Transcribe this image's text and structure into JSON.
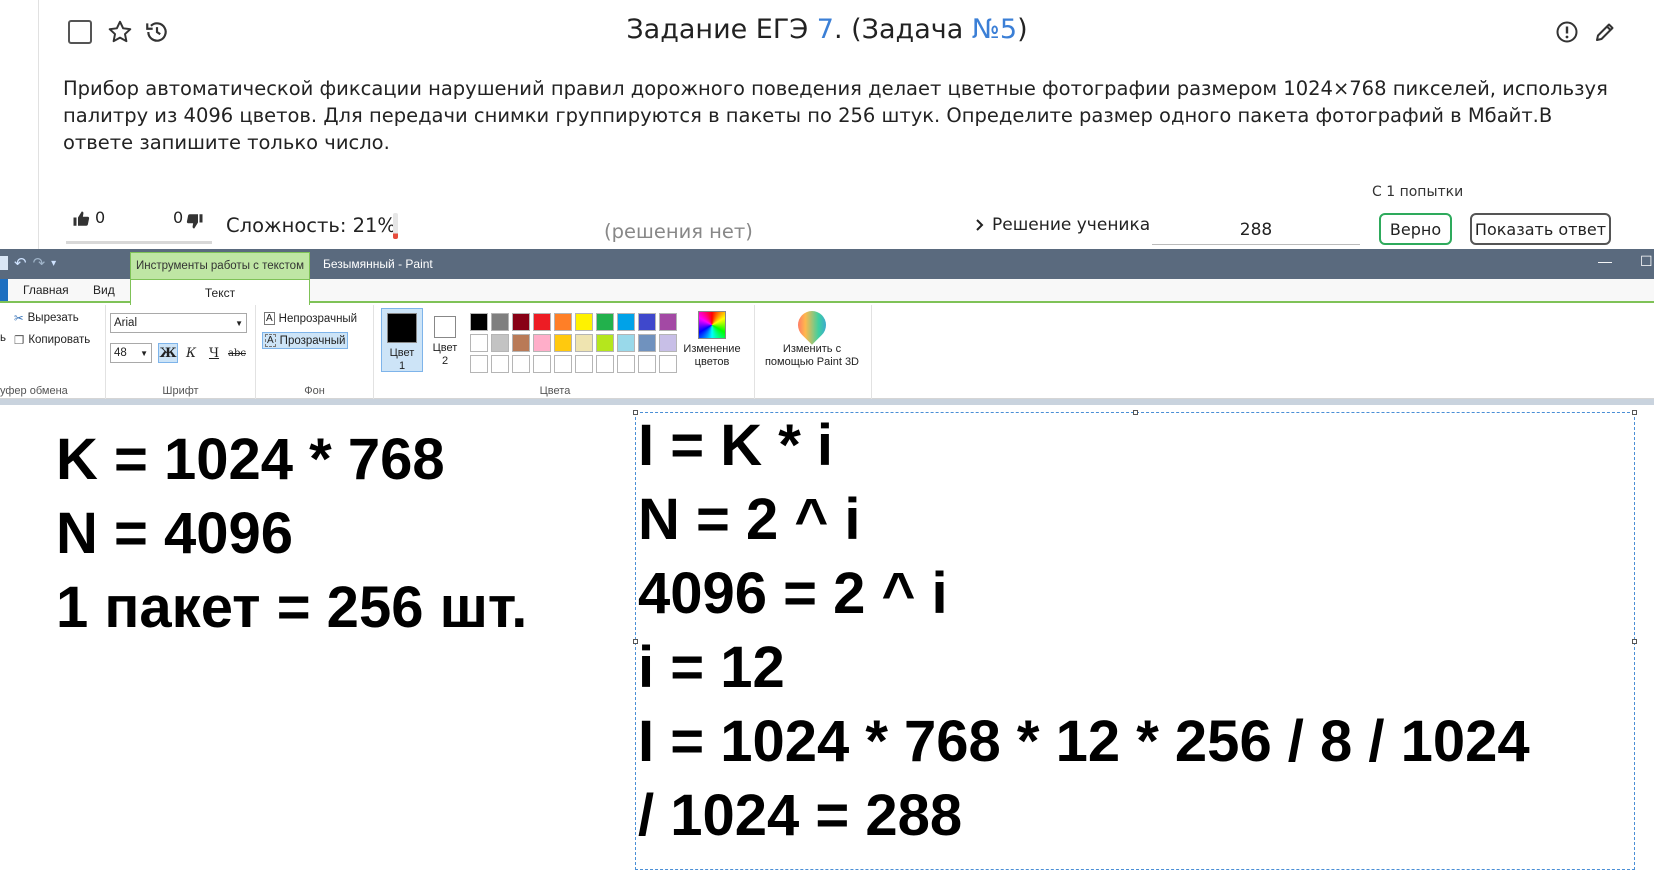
{
  "task": {
    "title_prefix": "Задание ЕГЭ ",
    "title_number": "7",
    "title_middle": ". (Задача ",
    "title_task_link": "№5",
    "title_suffix": ")",
    "text": "Прибор автоматической фиксации нарушений правил дорожного поведения делает цветные фотографии размером 1024×768 пикселей, используя палитру из 4096 цветов. Для передачи снимки группируются в пакеты по 256 штук. Определите размер одного пакета фотографий в Мбайт.В ответе запишите только число.",
    "likes": "0",
    "dislikes": "0",
    "difficulty_label": "Сложность: 21%",
    "difficulty_percent": 21,
    "no_solutions": "(решения нет)",
    "student_solution": "Решение ученика",
    "attempts": "С 1 попытки",
    "answer_value": "288",
    "correct_label": "Верно",
    "show_answer_label": "Показать ответ"
  },
  "paint": {
    "context_tab": "Инструменты работы с текстом",
    "window_title": "Безымянный - Paint",
    "tabs": [
      "Главная",
      "Вид"
    ],
    "active_tab": "Текст",
    "clipboard": {
      "cut": "Вырезать",
      "copy": "Копировать",
      "paste_fragment": "ь",
      "label": "уфер обмена"
    },
    "font": {
      "family": "Arial",
      "size": "48",
      "bold": "Ж",
      "italic": "К",
      "underline": "Ч",
      "strike": "abc",
      "label": "Шрифт"
    },
    "background": {
      "opaque": "Непрозрачный",
      "transparent": "Прозрачный",
      "label": "Фон"
    },
    "colors": {
      "color1": "Цвет 1",
      "color2": "Цвет 2",
      "edit_colors": "Изменение цветов",
      "paint3d": "Изменить с помощью Paint 3D",
      "label": "Цвета",
      "row1": [
        "#000000",
        "#7f7f7f",
        "#880015",
        "#ed1c24",
        "#ff7f27",
        "#fff200",
        "#22b14c",
        "#00a2e8",
        "#3f48cc",
        "#a349a4"
      ],
      "row2": [
        "#ffffff",
        "#c3c3c3",
        "#b97a57",
        "#ffaec9",
        "#ffc90e",
        "#efe4b0",
        "#b5e61d",
        "#99d9ea",
        "#7092be",
        "#c8bfe7"
      ]
    },
    "canvas_left": [
      "K = 1024 * 768",
      "N = 4096",
      "1 пакет = 256 шт."
    ],
    "canvas_right": [
      "I = K  * i",
      "N = 2 ^ i",
      "4096 = 2 ^ i",
      "i = 12",
      "I = 1024 * 768 * 12 * 256 / 8 / 1024",
      "/ 1024 = 288"
    ]
  }
}
